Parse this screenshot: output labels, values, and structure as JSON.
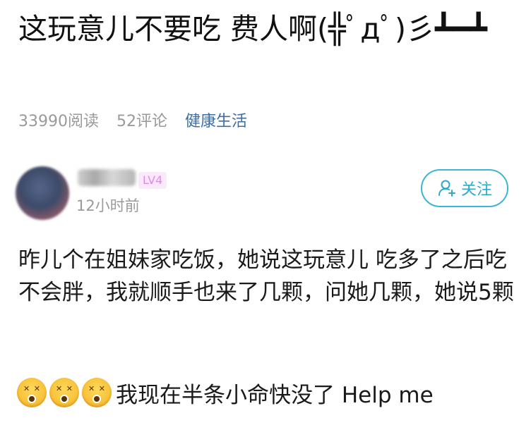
{
  "post": {
    "title": "这玩意儿不要吃 费人啊(╬ﾟдﾟ)彡┻━┻",
    "reads": "33990阅读",
    "comments": "52评论",
    "category": "健康生活"
  },
  "author": {
    "username": "",
    "level": "LV4",
    "time": "12小时前",
    "follow_label": "关注"
  },
  "content": {
    "paragraph": "昨儿个在姐妹家吃饭，她说这玩意儿 吃多了之后吃不会胖，我就顺手也来了几颗，问她几颗，她说5颗",
    "emoji_text": "我现在半条小命快没了 Help me",
    "emoji_icons": [
      "dizzy-face-emoji",
      "dizzy-face-emoji",
      "dizzy-face-emoji"
    ]
  },
  "colors": {
    "accent": "#3bb6d3",
    "category": "#3d6da8",
    "level_badge": "#e28ae8"
  }
}
